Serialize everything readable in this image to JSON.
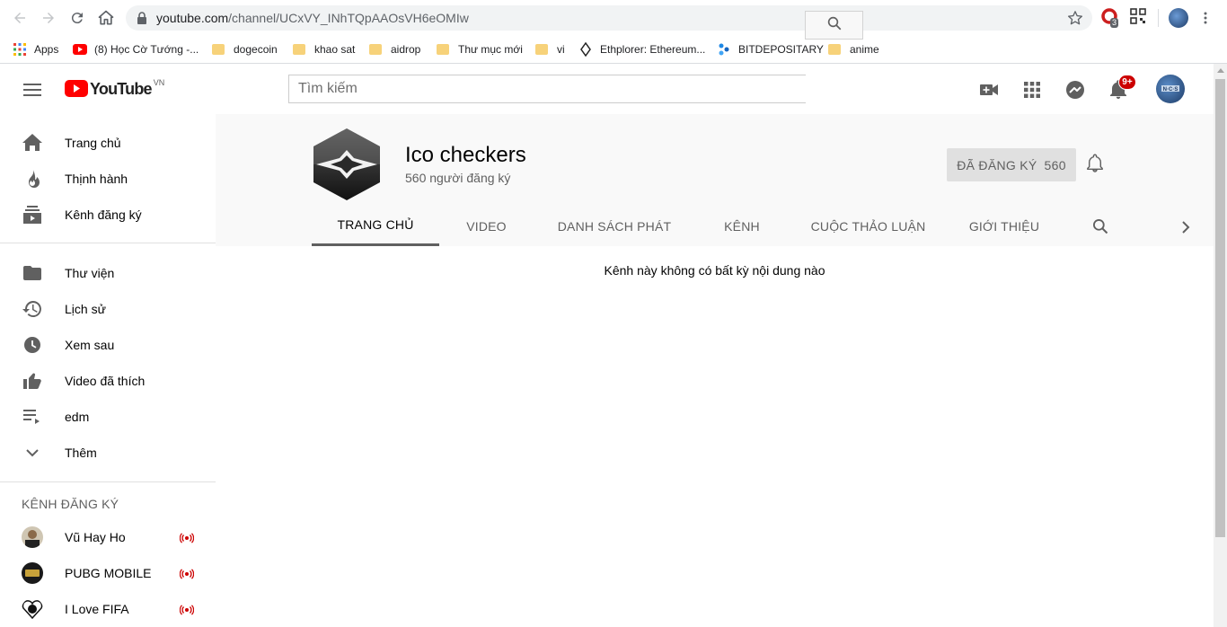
{
  "browser": {
    "url_host": "youtube.com",
    "url_path": "/channel/UCxVY_INhTQpAAOsVH6eOMIw",
    "ext_badge": "3",
    "bookmarks": [
      {
        "label": "Apps",
        "icon": "apps-grid-icon"
      },
      {
        "label": "(8) Học Cờ Tướng -...",
        "icon": "youtube-favicon"
      },
      {
        "label": "dogecoin",
        "icon": "folder-icon"
      },
      {
        "label": "khao sat",
        "icon": "folder-icon"
      },
      {
        "label": "aidrop",
        "icon": "folder-icon"
      },
      {
        "label": "Thư mục mới",
        "icon": "folder-icon"
      },
      {
        "label": "vi",
        "icon": "folder-icon"
      },
      {
        "label": "Ethplorer: Ethereum...",
        "icon": "ethereum-icon"
      },
      {
        "label": "BITDEPOSITARY",
        "icon": "bitdepositary-icon"
      },
      {
        "label": "anime",
        "icon": "folder-icon"
      }
    ]
  },
  "masthead": {
    "logo_text": "YouTube",
    "country_code": "VN",
    "search_placeholder": "Tìm kiếm",
    "notification_count": "9+"
  },
  "sidebar": {
    "primary": [
      {
        "label": "Trang chủ",
        "icon": "home-icon"
      },
      {
        "label": "Thịnh hành",
        "icon": "fire-icon"
      },
      {
        "label": "Kênh đăng ký",
        "icon": "subscriptions-icon"
      }
    ],
    "library": [
      {
        "label": "Thư viện",
        "icon": "folder-icon"
      },
      {
        "label": "Lịch sử",
        "icon": "history-icon"
      },
      {
        "label": "Xem sau",
        "icon": "clock-icon"
      },
      {
        "label": "Video đã thích",
        "icon": "thumbs-up-icon"
      },
      {
        "label": "edm",
        "icon": "playlist-icon"
      },
      {
        "label": "Thêm",
        "icon": "chevron-down-icon"
      }
    ],
    "subscriptions_heading": "KÊNH ĐĂNG KÝ",
    "subscriptions": [
      {
        "label": "Vũ Hay Ho"
      },
      {
        "label": "PUBG MOBILE"
      },
      {
        "label": "I Love FIFA"
      }
    ]
  },
  "channel": {
    "name": "Ico checkers",
    "subscribers": "560 người đăng ký",
    "subscribe_label": "ĐÃ ĐĂNG KÝ",
    "subscribe_count": "560",
    "tabs": [
      "TRANG CHỦ",
      "VIDEO",
      "DANH SÁCH PHÁT",
      "KÊNH",
      "CUỘC THẢO LUẬN",
      "GIỚI THIỆU"
    ],
    "active_tab": "TRANG CHỦ",
    "empty_message": "Kênh này không có bất kỳ nội dung nào"
  },
  "colors": {
    "youtube_red": "#ff0000",
    "live_red": "#cc0000",
    "header_bg": "#f9f9f9"
  }
}
